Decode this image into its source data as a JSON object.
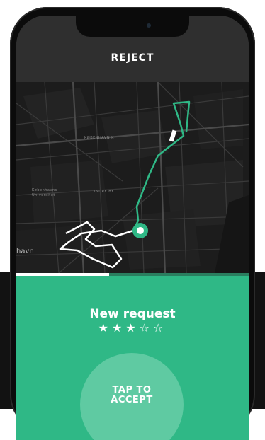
{
  "header": {
    "reject_label": "REJECT"
  },
  "map": {
    "labels": {
      "kobenhavn_k": "KØBENHAVN K",
      "indre_by": "INDRE BY",
      "university": "Københavns\nUniversitet",
      "area_edge": "havn"
    },
    "route_color": "#2fb886"
  },
  "request": {
    "title": "New request",
    "rating": 3,
    "rating_max": 5,
    "stars_text": "★★★☆☆",
    "progress_fraction": 0.4
  },
  "accept": {
    "label": "TAP TO\nACCEPT"
  },
  "colors": {
    "accent": "#2fb886",
    "header_bg": "#2f2f2f",
    "map_bg": "#1c1c1c"
  }
}
